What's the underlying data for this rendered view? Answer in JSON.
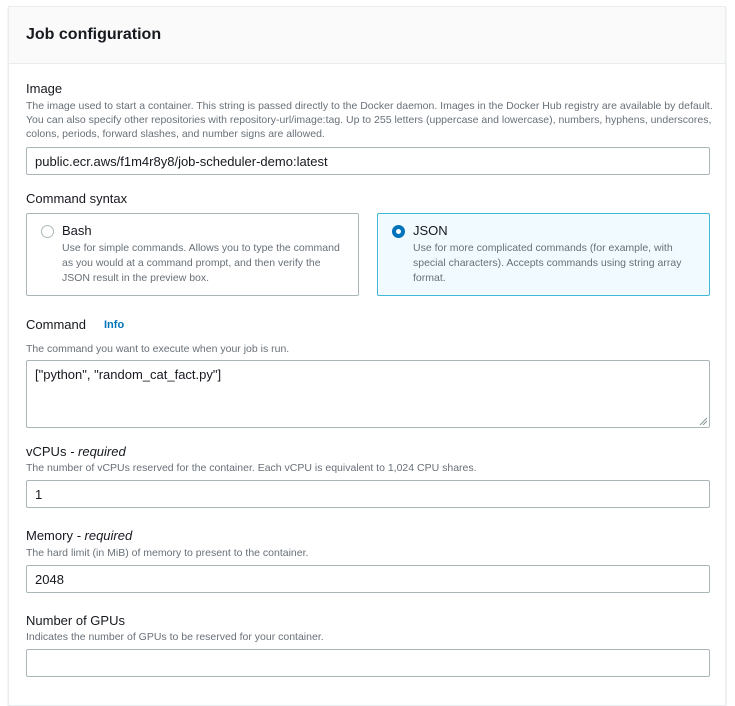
{
  "panel": {
    "title": "Job configuration"
  },
  "image": {
    "label": "Image",
    "description": "The image used to start a container. This string is passed directly to the Docker daemon. Images in the Docker Hub registry are available by default. You can also specify other repositories with repository-url/image:tag. Up to 255 letters (uppercase and lowercase), numbers, hyphens, underscores, colons, periods, forward slashes, and number signs are allowed.",
    "value": "public.ecr.aws/f1m4r8y8/job-scheduler-demo:latest"
  },
  "command_syntax": {
    "label": "Command syntax",
    "options": [
      {
        "label": "Bash",
        "description": "Use for simple commands. Allows you to type the command as you would at a command prompt, and then verify the JSON result in the preview box.",
        "selected": false
      },
      {
        "label": "JSON",
        "description": "Use for more complicated commands (for example, with special characters). Accepts commands using string array format.",
        "selected": true
      }
    ]
  },
  "command": {
    "label": "Command",
    "info": "Info",
    "description": "The command you want to execute when your job is run.",
    "value": "[\"python\", \"random_cat_fact.py\"]"
  },
  "vcpus": {
    "label": "vCPUs",
    "required": "- required",
    "description": "The number of vCPUs reserved for the container. Each vCPU is equivalent to 1,024 CPU shares.",
    "value": "1"
  },
  "memory": {
    "label": "Memory",
    "required": "- required",
    "description": "The hard limit (in MiB) of memory to present to the container.",
    "value": "2048"
  },
  "gpus": {
    "label": "Number of GPUs",
    "description": "Indicates the number of GPUs to be reserved for your container.",
    "value": ""
  }
}
